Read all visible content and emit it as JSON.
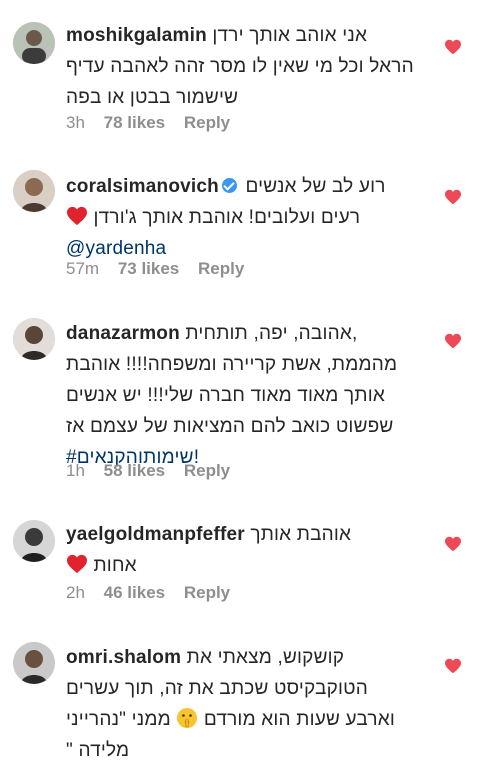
{
  "colors": {
    "heart": "#ed4956",
    "meta": "#8e8e8e",
    "link": "#003569",
    "verified": "#3897f0"
  },
  "comments": [
    {
      "username": "moshikgalamin",
      "line1": "אני אוהב אותך ירדן",
      "lines": [
        "הראל וכל מי שאין לו מסר זהה לאהבה עדיף",
        "שישמור בבטן או בפה"
      ],
      "time": "3h",
      "likes": "78 likes",
      "reply": "Reply"
    },
    {
      "username": "coralsimanovich",
      "verified": true,
      "line1": "רוע לב של אנשים",
      "line2": "רעים ועלובים! אוהבת אותך ג'ורדן",
      "mention": "@yardenha",
      "time": "57m",
      "likes": "73 likes",
      "reply": "Reply"
    },
    {
      "username": "danazarmon",
      "line1": "אהובה, יפה, תותחית,",
      "lines": [
        "מהממת, אשת קריירה ומשפחה!!!! אוהבת",
        "אותך מאוד מאוד חברה שלי!!! יש אנשים",
        "שפשוט כואב להם המציאות של עצמם אז"
      ],
      "hashtag": "#שימותוהקנאים!",
      "time": "1h",
      "likes": "58 likes",
      "reply": "Reply"
    },
    {
      "username": "yaelgoldmanpfeffer",
      "line1": "אוהבת אותך",
      "line2": "אחות",
      "time": "2h",
      "likes": "46 likes",
      "reply": "Reply"
    },
    {
      "username": "omri.shalom",
      "line1": "קושקוש, מצאתי את",
      "line2": "הטוקבקיסט שכתב את זה, תוך עשרים",
      "line3a": "וארבע שעות הוא מורדם",
      "line3b": "ממני \"נהרייני",
      "line4": "\" מלידה"
    }
  ]
}
